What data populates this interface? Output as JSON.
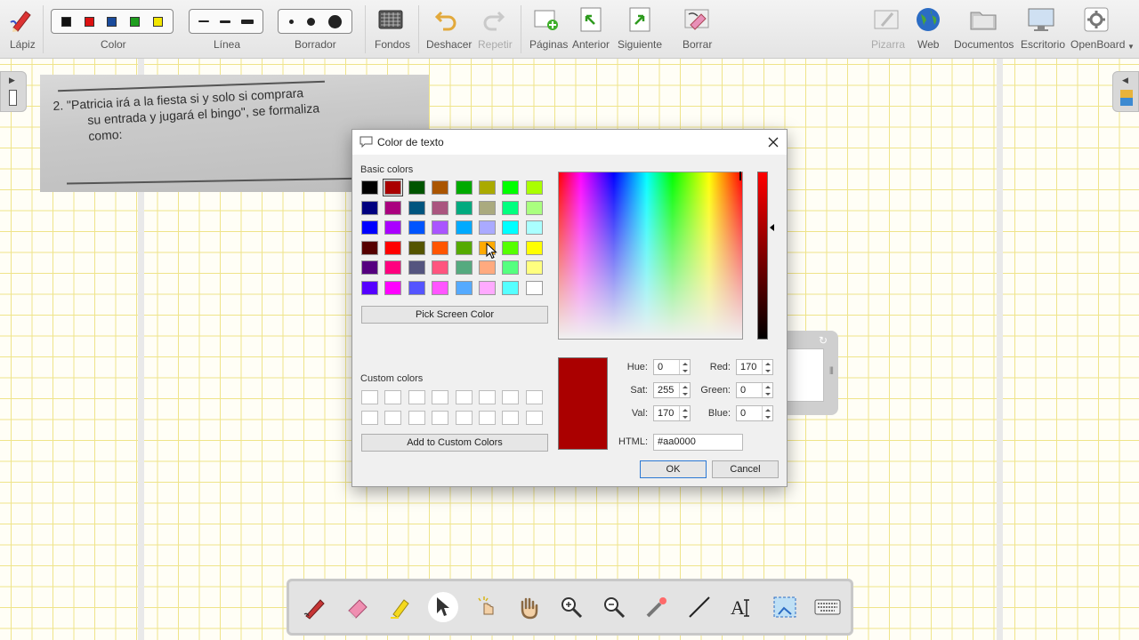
{
  "toolbar": {
    "pencil_label": "Lápiz",
    "color_label": "Color",
    "line_label": "Línea",
    "eraser_label": "Borrador",
    "backgrounds_label": "Fondos",
    "undo_label": "Deshacer",
    "redo_label": "Repetir",
    "pages_label": "Páginas",
    "previous_label": "Anterior",
    "next_label": "Siguiente",
    "erase_label": "Borrar",
    "board_label": "Pizarra",
    "web_label": "Web",
    "documents_label": "Documentos",
    "desktop_label": "Escritorio",
    "openboard_label": "OpenBoard",
    "colors": [
      "#111111",
      "#dd1111",
      "#1a4b9c",
      "#1e9e1e",
      "#f2e600"
    ]
  },
  "photo": {
    "line1": "2.   \"Patricia irá a la fiesta si y solo si comprara",
    "line2": "su entrada y jugará el bingo\", se formaliza",
    "line3": "como:"
  },
  "dialog": {
    "title": "Color de texto",
    "basic_colors_label": "Basic colors",
    "custom_colors_label": "Custom colors",
    "pick_screen_color": "Pick Screen Color",
    "add_to_custom": "Add to Custom Colors",
    "basic_colors": [
      "#000000",
      "#aa0000",
      "#005500",
      "#aa5500",
      "#00aa00",
      "#aaaa00",
      "#00ff00",
      "#aaff00",
      "#00007f",
      "#aa007f",
      "#00557f",
      "#aa557f",
      "#00aa7f",
      "#aaaa7f",
      "#00ff7f",
      "#aaff7f",
      "#0000ff",
      "#aa00ff",
      "#0055ff",
      "#aa55ff",
      "#00aaff",
      "#aaaaff",
      "#00ffff",
      "#aaffff",
      "#550000",
      "#ff0000",
      "#555500",
      "#ff5500",
      "#55aa00",
      "#ffaa00",
      "#55ff00",
      "#ffff00",
      "#55007f",
      "#ff007f",
      "#55557f",
      "#ff557f",
      "#55aa7f",
      "#ffaa7f",
      "#55ff7f",
      "#ffff7f",
      "#5500ff",
      "#ff00ff",
      "#5555ff",
      "#ff55ff",
      "#55aaff",
      "#ffaaff",
      "#55ffff",
      "#ffffff"
    ],
    "selected_index": 1,
    "hue_label": "Hue:",
    "hue": "0",
    "sat_label": "Sat:",
    "sat": "255",
    "val_label": "Val:",
    "val": "170",
    "red_label": "Red:",
    "red": "170",
    "green_label": "Green:",
    "green": "0",
    "blue_label": "Blue:",
    "blue": "0",
    "html_label": "HTML:",
    "html_value": "#aa0000",
    "current_color": "#aa0000",
    "ok": "OK",
    "cancel": "Cancel"
  }
}
